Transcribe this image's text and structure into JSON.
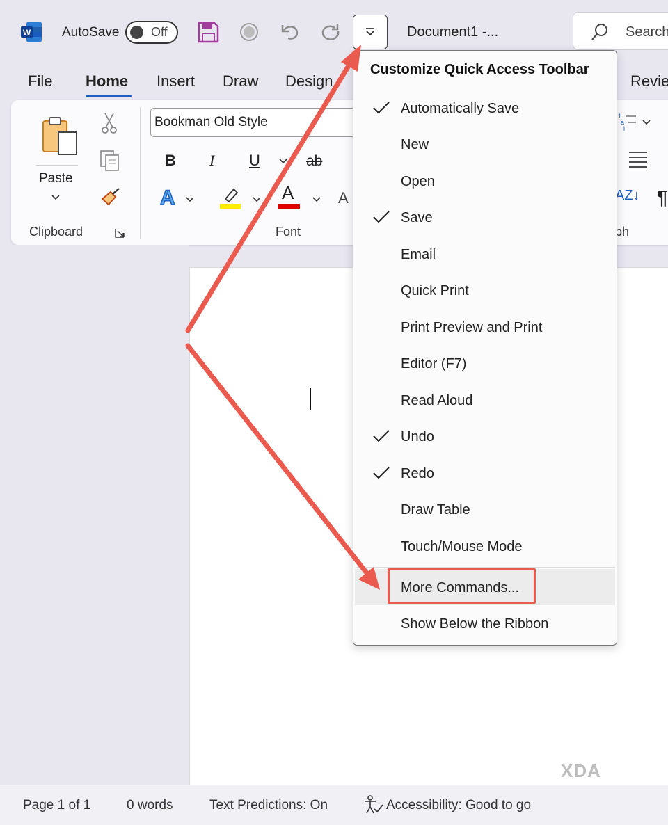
{
  "titlebar": {
    "autosave_label": "AutoSave",
    "autosave_state": "Off",
    "document_title": "Document1  -...",
    "search_placeholder": "Search"
  },
  "tabs": [
    {
      "label": "File"
    },
    {
      "label": "Home",
      "active": true
    },
    {
      "label": "Insert"
    },
    {
      "label": "Draw"
    },
    {
      "label": "Design"
    },
    {
      "label": "Revie"
    }
  ],
  "ribbon": {
    "paste_label": "Paste",
    "clipboard_label": "Clipboard",
    "font_name": "Bookman Old Style",
    "font_label": "Font",
    "paragraph_label_partial": "ph",
    "bold": "B",
    "italic": "I",
    "underline": "U",
    "strike": "ab",
    "text_effect": "A",
    "font_color": "A",
    "aa": "A",
    "sort": "AZ↓",
    "pilcrow": "¶"
  },
  "menu": {
    "title": "Customize Quick Access Toolbar",
    "items": [
      {
        "label": "Automatically Save",
        "checked": true
      },
      {
        "label": "New",
        "checked": false
      },
      {
        "label": "Open",
        "checked": false
      },
      {
        "label": "Save",
        "checked": true
      },
      {
        "label": "Email",
        "checked": false
      },
      {
        "label": "Quick Print",
        "checked": false
      },
      {
        "label": "Print Preview and Print",
        "checked": false
      },
      {
        "label": "Editor (F7)",
        "checked": false
      },
      {
        "label": "Read Aloud",
        "checked": false
      },
      {
        "label": "Undo",
        "checked": true
      },
      {
        "label": "Redo",
        "checked": true
      },
      {
        "label": "Draw Table",
        "checked": false
      },
      {
        "label": "Touch/Mouse Mode",
        "checked": false
      }
    ],
    "more_commands": "More Commands...",
    "show_below": "Show Below the Ribbon"
  },
  "statusbar": {
    "page": "Page 1 of 1",
    "words": "0 words",
    "predictions": "Text Predictions: On",
    "accessibility": "Accessibility: Good to go"
  },
  "watermark": "XDA",
  "colors": {
    "accent_blue": "#1e5fc6",
    "annotation_red": "#ea5a4f",
    "save_icon_purple": "#a23c9c",
    "highlight_yellow": "#ffee00",
    "font_color_red": "#e00000"
  }
}
